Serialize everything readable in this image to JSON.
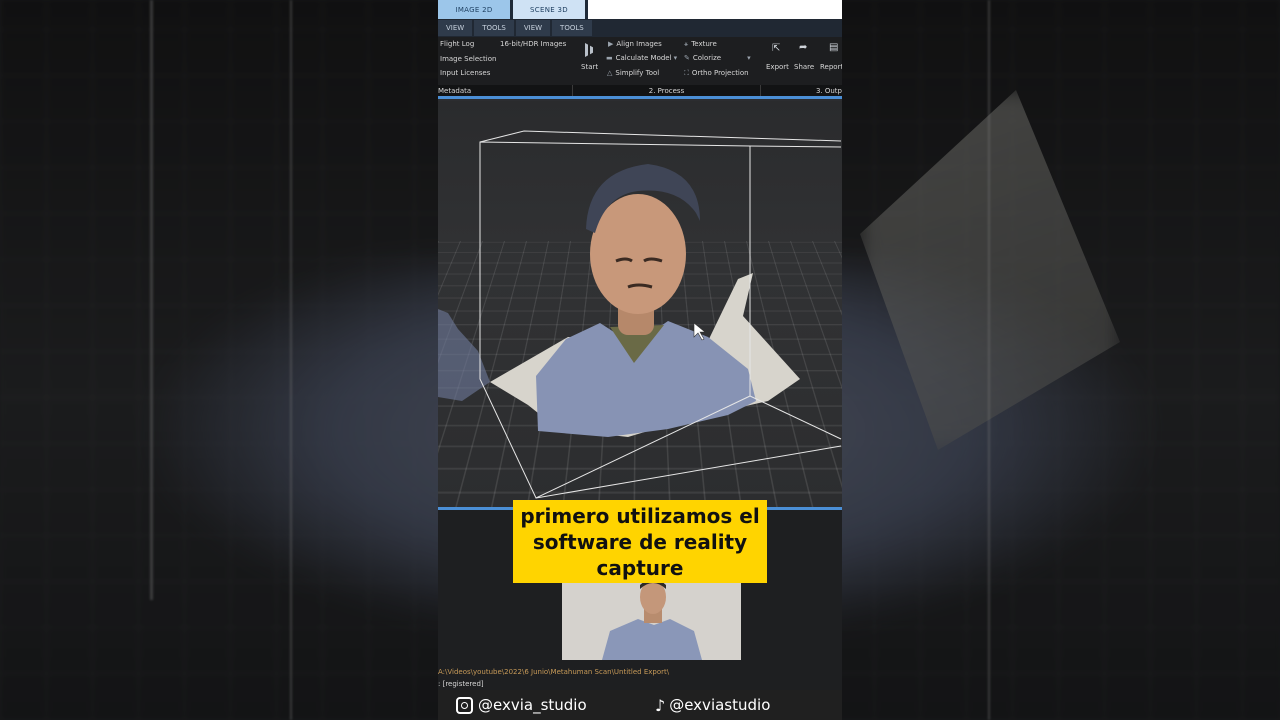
{
  "app": {
    "top_tabs": [
      "IMAGE 2D",
      "SCENE 3D"
    ],
    "sub_tabs": [
      "VIEW",
      "TOOLS",
      "VIEW",
      "TOOLS"
    ],
    "workflow": {
      "flight_log": "Flight Log",
      "hdr_images": "16-bit/HDR Images",
      "image_selection": "Image Selection",
      "input_licenses": "Input Licenses"
    },
    "process": {
      "start": "Start",
      "align_images": "Align Images",
      "calculate_model": "Calculate Model",
      "simplify_tool": "Simplify Tool",
      "texture": "Texture",
      "colorize": "Colorize",
      "ortho_projection": "Ortho Projection"
    },
    "output": {
      "export": "Export",
      "share": "Share",
      "report": "Report"
    },
    "sections": [
      "Metadata",
      "2. Process",
      "3. Outp"
    ],
    "console_path": "A:\\Videos\\youtube\\2022\\6 Junio\\Metahuman Scan\\Untitled Export\\",
    "console_status": ": [registered]"
  },
  "caption": {
    "lines": [
      "primero utilizamos el",
      "software de reality",
      "capture"
    ],
    "background": "#ffd400"
  },
  "social": {
    "instagram": "@exvia_studio",
    "tiktok": "@exviastudio"
  },
  "colors": {
    "accent_blue": "#4b8fd6",
    "console_path": "#c79a58"
  }
}
